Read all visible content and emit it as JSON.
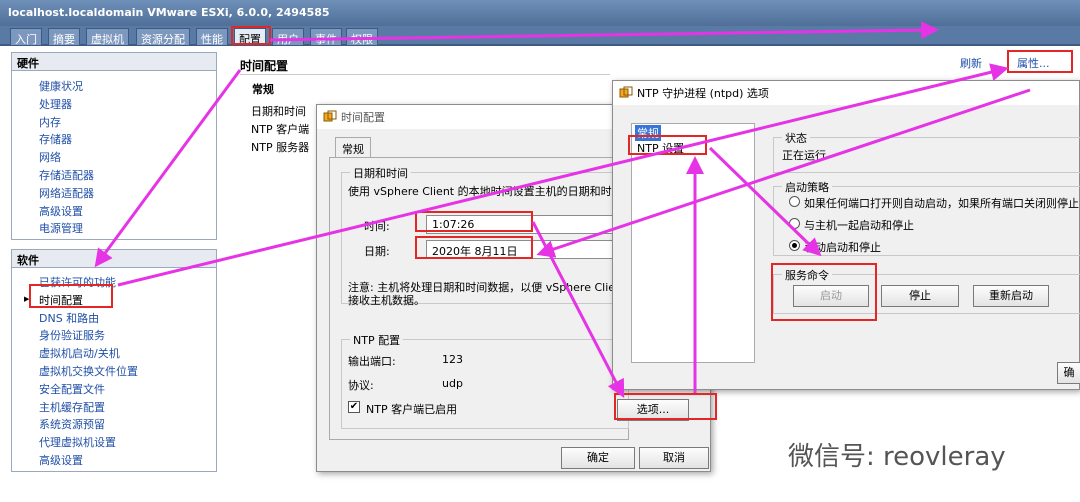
{
  "window": {
    "title": "localhost.localdomain VMware ESXi, 6.0.0, 2494585"
  },
  "tabs": [
    {
      "label": "入门"
    },
    {
      "label": "摘要"
    },
    {
      "label": "虚拟机"
    },
    {
      "label": "资源分配"
    },
    {
      "label": "性能"
    },
    {
      "label": "配置",
      "active": true
    },
    {
      "label": "用户"
    },
    {
      "label": "事件"
    },
    {
      "label": "权限"
    }
  ],
  "hardware": {
    "title": "硬件",
    "items": [
      "健康状况",
      "处理器",
      "内存",
      "存储器",
      "网络",
      "存储适配器",
      "网络适配器",
      "高级设置",
      "电源管理"
    ]
  },
  "software": {
    "title": "软件",
    "items": [
      "已获许可的功能",
      "时间配置",
      "DNS 和路由",
      "身份验证服务",
      "虚拟机启动/关机",
      "虚拟机交换文件位置",
      "安全配置文件",
      "主机缓存配置",
      "系统资源预留",
      "代理虚拟机设置",
      "高级设置"
    ]
  },
  "main": {
    "title": "时间配置",
    "refresh": "刷新",
    "properties": "属性...",
    "section": "常规",
    "rows": [
      "日期和时间",
      "NTP 客户端",
      "NTP 服务器"
    ]
  },
  "time_dialog": {
    "title": "时间配置",
    "tab": "常规",
    "datetime_group": "日期和时间",
    "desc": "使用 vSphere Client 的本地时间设置主机的日期和时间",
    "time_label": "时间:",
    "time_value": "1:07:26",
    "date_label": "日期:",
    "date_value": "2020年 8月11日",
    "note": "注意: 主机将处理日期和时间数据，以便 vSphere Client",
    "note2": "接收主机数据。",
    "ntp_group": "NTP 配置",
    "port_label": "输出端口:",
    "port_value": "123",
    "proto_label": "协议:",
    "proto_value": "udp",
    "ntp_enabled": "NTP 客户端已启用",
    "options_btn": "选项...",
    "ok": "确定",
    "cancel": "取消"
  },
  "ntp_dialog": {
    "title": "NTP 守护进程 (ntpd) 选项",
    "tree": [
      "常规",
      "NTP 设置"
    ],
    "status_group": "状态",
    "status_value": "正在运行",
    "policy_group": "启动策略",
    "policy_options": [
      "如果任何端口打开则自动启动，如果所有端口关闭则停止",
      "与主机一起启动和停止",
      "手动启动和停止"
    ],
    "policy_selected": 2,
    "cmd_group": "服务命令",
    "start": "启动",
    "stop": "停止",
    "restart": "重新启动",
    "partial_btn": "确"
  },
  "watermark": "微信号: reovleray",
  "colors": {
    "annotation": "#e32727",
    "arrow": "#e533e5",
    "link": "#1f4fa6"
  }
}
